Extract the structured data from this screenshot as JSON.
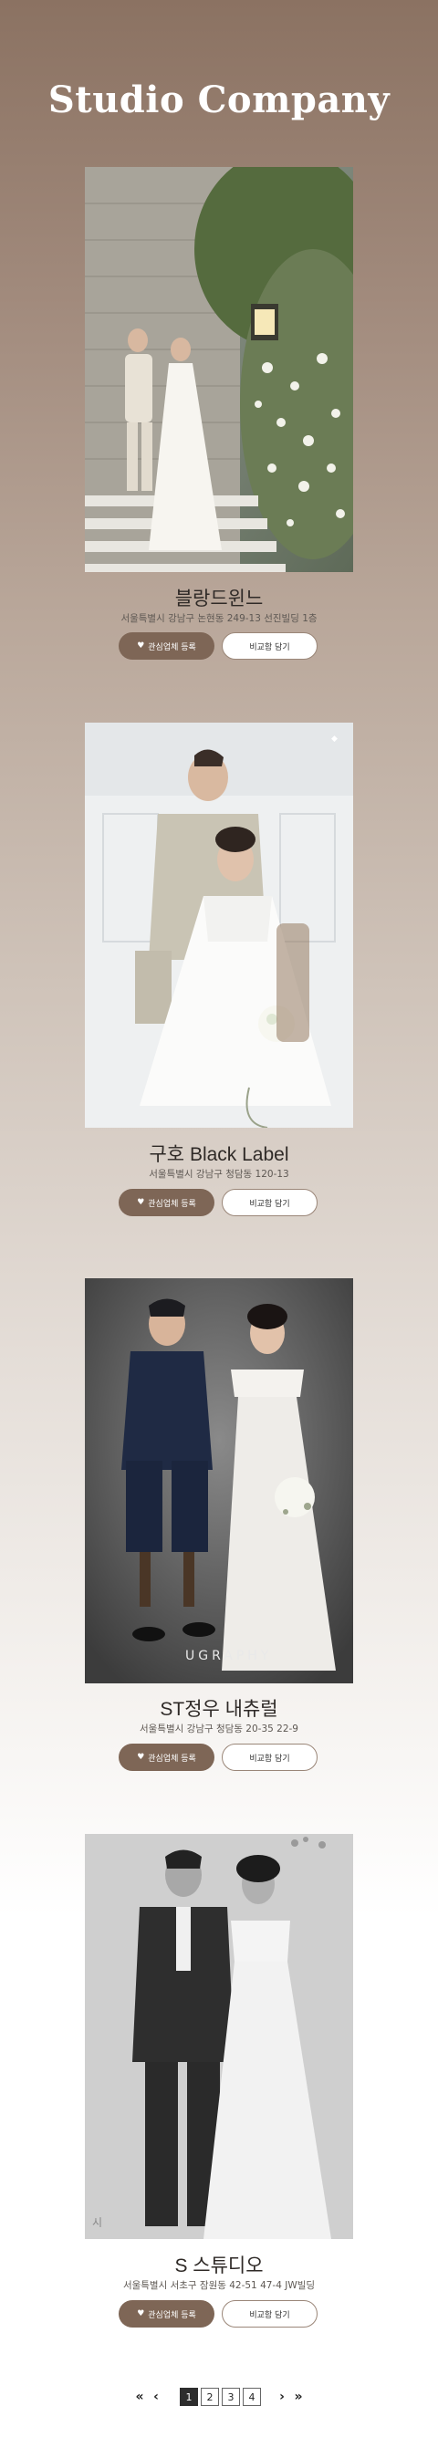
{
  "header": {
    "title": "Studio Company"
  },
  "cards": [
    {
      "name": "블랑드윈느",
      "address": "서울특별시 강남구 논현동 249-13 선진빌딩 1층",
      "fav_label": "관심업체 등록",
      "compare_label": "비교함 담기"
    },
    {
      "name": "구호 Black Label",
      "address": "서울특별시 강남구 청담동 120-13",
      "fav_label": "관심업체 등록",
      "compare_label": "비교함 담기"
    },
    {
      "name": "ST정우 내츄럴",
      "address": "서울특별시 강남구 청담동 20-35 22-9",
      "fav_label": "관심업체 등록",
      "compare_label": "비교함 담기",
      "photo_overlay": "UGRAPHY"
    },
    {
      "name": "S 스튜디오",
      "address": "서울특별시 서초구 잠원동 42-51 47-4 JW빌딩",
      "fav_label": "관심업체 등록",
      "compare_label": "비교함 담기",
      "photo_overlay": "시"
    }
  ],
  "pagination": {
    "first": "«",
    "prev": "‹",
    "next": "›",
    "last": "»",
    "pages": [
      "1",
      "2",
      "3",
      "4"
    ],
    "current": "1"
  },
  "colors": {
    "accent": "#7e6656",
    "bg_top": "#8b7262",
    "bg_bottom": "#ffffff"
  }
}
